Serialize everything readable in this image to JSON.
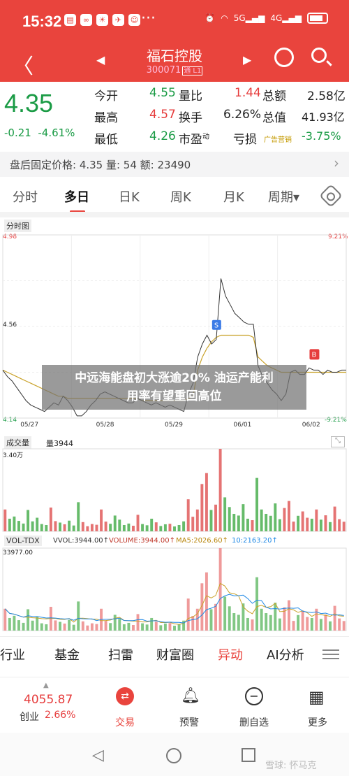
{
  "status": {
    "time": "15:32",
    "dots": "···"
  },
  "header": {
    "title": "福石控股",
    "code": "300071",
    "code_tag": "通 L1"
  },
  "quote": {
    "price": "4.35",
    "change": "-0.21",
    "change_pct": "-4.61%",
    "open_label": "今开",
    "open": "4.55",
    "high_label": "最高",
    "high": "4.57",
    "low_label": "最低",
    "low": "4.26",
    "volratio_label": "量比",
    "volratio": "1.44",
    "turnover_label": "换手",
    "turnover": "6.26%",
    "pe_label": "市盈",
    "pe_sup": "动",
    "amount_label": "总额",
    "amount": "2.58亿",
    "mktcap_label": "总值",
    "mktcap": "41.93亿",
    "loss_label": "亏损",
    "ad_label": "广告营销",
    "ad_pct": "-3.75%"
  },
  "after_hours": {
    "text": "盘后固定价格: 4.35  量: 54  额: 23490"
  },
  "tabs": [
    {
      "label": "分时",
      "active": false
    },
    {
      "label": "多日",
      "active": true
    },
    {
      "label": "日K",
      "active": false
    },
    {
      "label": "周K",
      "active": false
    },
    {
      "label": "月K",
      "active": false
    },
    {
      "label": "周期▾",
      "active": false
    }
  ],
  "price_chart": {
    "label": "分时图",
    "top_left": "4.98",
    "top_right": "9.21%",
    "mid_left": "4.56",
    "bot_left": "4.14",
    "bot_right": "-9.21%",
    "dates": [
      "05/27",
      "05/28",
      "05/29",
      "06/01",
      "06/02"
    ],
    "marker_s": "S",
    "marker_b": "B"
  },
  "volume_panel": {
    "label": "成交量",
    "value_label": "量3944",
    "max": "3.40万"
  },
  "vol_tdx": {
    "label": "VOL-TDX",
    "vvol": "VVOL:3944.00↑",
    "volume": "VOLUME:3944.00↑",
    "ma5": "MA5:2026.60↑",
    "ma10": "10:2163.20↑",
    "max": "33977.00"
  },
  "overlay": {
    "line1": "中远海能盘初大涨逾20% 油运产能利",
    "line2": "用率有望重回高位"
  },
  "toolbar": [
    "行业",
    "基金",
    "扫雷",
    "财富圈",
    "异动",
    "AI分析"
  ],
  "bottom": {
    "index_value": "4055.87",
    "index_name": "创业",
    "index_pct": "2.66%",
    "trade": "交易",
    "alert": "预警",
    "remove": "删自选",
    "more": "更多"
  },
  "watermark": "雪球: 怀马克",
  "colors": {
    "red": "#e9443d",
    "green": "#1a9b45",
    "yellow": "#c9a22a"
  },
  "chart_data": [
    {
      "type": "line",
      "title": "分时图",
      "x": [
        "05/27",
        "05/28",
        "05/29",
        "06/01",
        "06/02"
      ],
      "ylim": [
        4.14,
        4.98
      ],
      "series": [],
      "price_series": [
        4.36,
        4.33,
        4.31,
        4.28,
        4.25,
        4.22,
        4.2,
        4.19,
        4.18,
        4.17,
        4.19,
        4.21,
        4.2,
        4.24,
        4.22,
        4.19,
        4.15,
        4.15,
        4.17,
        4.2,
        4.22,
        4.25,
        4.26,
        4.25,
        4.24,
        4.23,
        4.22,
        4.21,
        4.21,
        4.23,
        4.22,
        4.21,
        4.2,
        4.21,
        4.2,
        4.19,
        4.2,
        4.19,
        4.18,
        4.17,
        4.25,
        4.3,
        4.42,
        4.48,
        4.52,
        4.48,
        4.5,
        4.78,
        4.7,
        4.66,
        4.62,
        4.6,
        4.58,
        4.57,
        4.57,
        4.38,
        4.33,
        4.3,
        4.27,
        4.25,
        4.22,
        4.25,
        4.35,
        4.36,
        4.34,
        4.34,
        4.37,
        4.36,
        4.36,
        4.34,
        4.36,
        4.35,
        4.35,
        4.36,
        4.36
      ],
      "avg_series": [
        4.36,
        4.35,
        4.34,
        4.33,
        4.32,
        4.31,
        4.3,
        4.29,
        4.28,
        4.27,
        4.26,
        4.25,
        4.24,
        4.24,
        4.23,
        4.23,
        4.23,
        4.23,
        4.23,
        4.23,
        4.23,
        4.23,
        4.23,
        4.23,
        4.23,
        4.23,
        4.23,
        4.23,
        4.23,
        4.23,
        4.22,
        4.22,
        4.22,
        4.22,
        4.22,
        4.22,
        4.22,
        4.22,
        4.22,
        4.22,
        4.23,
        4.24,
        4.36,
        4.42,
        4.46,
        4.49,
        4.51,
        4.52,
        4.52,
        4.52,
        4.52,
        4.52,
        4.52,
        4.52,
        4.51,
        4.42,
        4.4,
        4.38,
        4.37,
        4.36,
        4.35,
        4.35,
        4.35,
        4.35,
        4.35,
        4.35,
        4.35,
        4.35,
        4.35,
        4.35,
        4.35,
        4.35,
        4.35,
        4.35,
        4.35
      ]
    },
    {
      "type": "bar",
      "title": "成交量",
      "ylim": [
        0,
        34000
      ],
      "values": [
        9000,
        5200,
        6100,
        4300,
        3200,
        8800,
        4100,
        5600,
        3000,
        2600,
        9800,
        4200,
        3600,
        2900,
        4400,
        2400,
        12000,
        3800,
        2100,
        3000,
        2700,
        9000,
        4000,
        3100,
        6500,
        4800,
        2600,
        3200,
        2300,
        6800,
        3000,
        2500,
        5200,
        3700,
        2200,
        2900,
        3100,
        2000,
        2600,
        4100,
        13200,
        6000,
        9000,
        19500,
        24000,
        8800,
        11000,
        34000,
        14000,
        10000,
        7200,
        6500,
        11200,
        5200,
        4600,
        22000,
        9000,
        7200,
        6400,
        11500,
        5000,
        9600,
        12500,
        4000,
        6400,
        8200,
        5600,
        5200,
        9000,
        4800,
        6600,
        3800,
        10200,
        5000,
        3944
      ]
    }
  ]
}
